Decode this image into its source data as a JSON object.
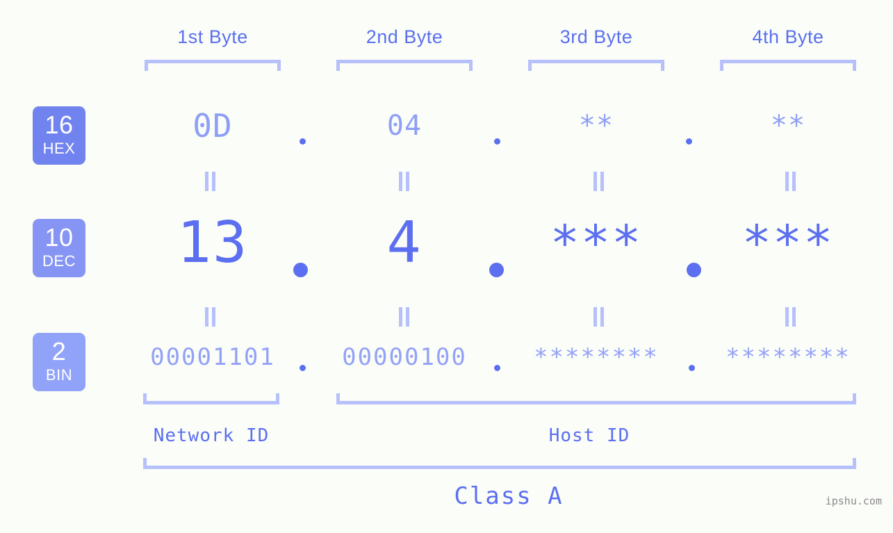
{
  "meta": {
    "background_color": "#fbfdf8",
    "accent_color": "#5b6ff0",
    "accent_light_color": "#b6c0fb",
    "watermark": "ipshu.com"
  },
  "byte_headers": [
    {
      "label": "1st Byte"
    },
    {
      "label": "2nd Byte"
    },
    {
      "label": "3rd Byte"
    },
    {
      "label": "4th Byte"
    }
  ],
  "bases": [
    {
      "number": "16",
      "name": "HEX",
      "color": "#7183ee"
    },
    {
      "number": "10",
      "name": "DEC",
      "color": "#8695f4"
    },
    {
      "number": "2",
      "name": "BIN",
      "color": "#90a3f8"
    }
  ],
  "rows": {
    "hex": {
      "values": [
        "0D",
        "04",
        "**",
        "**"
      ]
    },
    "dec": {
      "values": [
        "13",
        "4",
        "***",
        "***"
      ]
    },
    "bin": {
      "values": [
        "00001101",
        "00000100",
        "********",
        "********"
      ]
    }
  },
  "separators": {
    "dot": "."
  },
  "equality": {
    "symbol": "="
  },
  "segments": {
    "network_id": "Network ID",
    "host_id": "Host ID",
    "class": "Class A"
  },
  "chart_data": {
    "type": "table",
    "title": "IP address byte breakdown",
    "columns": [
      "1st Byte",
      "2nd Byte",
      "3rd Byte",
      "4th Byte"
    ],
    "rows": [
      {
        "base": "16 HEX",
        "values": [
          "0D",
          "04",
          "**",
          "**"
        ]
      },
      {
        "base": "10 DEC",
        "values": [
          "13",
          "4",
          "***",
          "***"
        ]
      },
      {
        "base": "2 BIN",
        "values": [
          "00001101",
          "00000100",
          "********",
          "********"
        ]
      }
    ],
    "network_id_bytes": 1,
    "host_id_bytes": 3,
    "address_class": "Class A"
  }
}
